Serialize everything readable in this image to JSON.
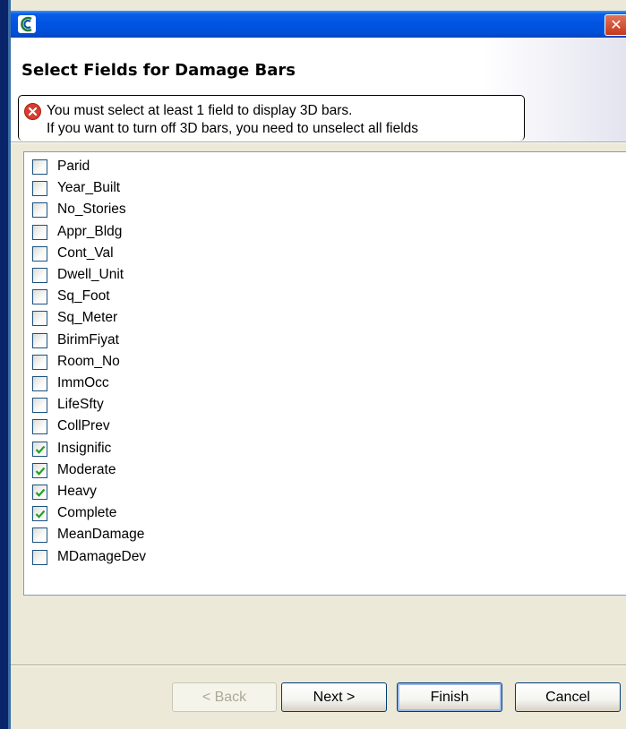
{
  "window": {
    "title": "",
    "close_label": "✕"
  },
  "header": {
    "title": "Select Fields for Damage Bars",
    "message_line1": "You must select at least 1 field to display 3D bars.",
    "message_line2": "If you want to turn off 3D bars, you need to unselect all fields"
  },
  "fields": [
    {
      "label": "Parid",
      "checked": false
    },
    {
      "label": "Year_Built",
      "checked": false
    },
    {
      "label": "No_Stories",
      "checked": false
    },
    {
      "label": "Appr_Bldg",
      "checked": false
    },
    {
      "label": "Cont_Val",
      "checked": false
    },
    {
      "label": "Dwell_Unit",
      "checked": false
    },
    {
      "label": "Sq_Foot",
      "checked": false
    },
    {
      "label": "Sq_Meter",
      "checked": false
    },
    {
      "label": "BirimFiyat",
      "checked": false
    },
    {
      "label": "Room_No",
      "checked": false
    },
    {
      "label": "ImmOcc",
      "checked": false
    },
    {
      "label": "LifeSfty",
      "checked": false
    },
    {
      "label": "CollPrev",
      "checked": false
    },
    {
      "label": "Insignific",
      "checked": true
    },
    {
      "label": "Moderate",
      "checked": true
    },
    {
      "label": "Heavy",
      "checked": true
    },
    {
      "label": "Complete",
      "checked": true
    },
    {
      "label": "MeanDamage",
      "checked": false
    },
    {
      "label": "MDamageDev",
      "checked": false
    }
  ],
  "buttons": {
    "back": "< Back",
    "next": "Next >",
    "finish": "Finish",
    "cancel": "Cancel"
  },
  "colors": {
    "titlebar": "#0054e3",
    "error_icon": "#d83b2f",
    "check_mark": "#21a121"
  }
}
